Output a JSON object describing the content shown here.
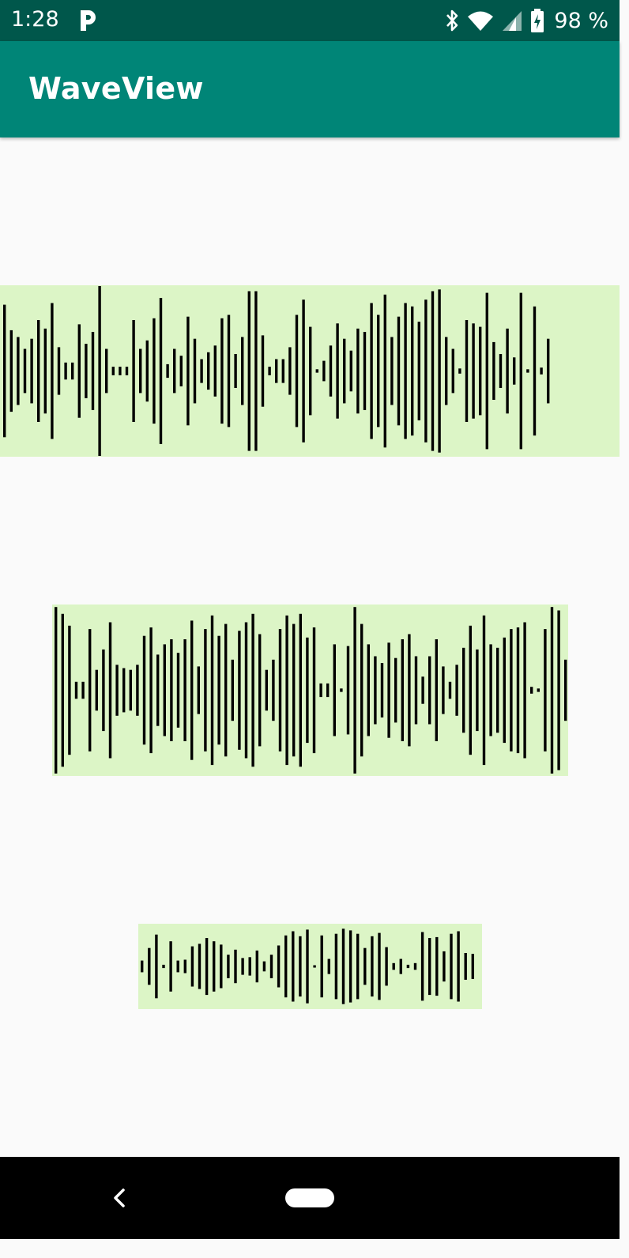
{
  "status_bar": {
    "time": "1:28",
    "notification_icon": "parking-p-icon",
    "icons": [
      "bluetooth-icon",
      "wifi-icon",
      "cell-signal-icon",
      "battery-charging-icon"
    ],
    "battery_text": "98 %",
    "background": "#00574b"
  },
  "app_bar": {
    "title": "WaveView",
    "background": "#008577"
  },
  "waves": {
    "background": "#dcf5c6",
    "bar_color": "#000000",
    "large": {
      "amplitudes": [
        0.78,
        0.48,
        0.4,
        0.26,
        0.38,
        0.6,
        0.5,
        0.8,
        0.28,
        0.1,
        0.1,
        0.55,
        0.32,
        0.46,
        1.0,
        0.26,
        0.05,
        0.05,
        0.05,
        0.6,
        0.26,
        0.36,
        0.62,
        0.86,
        0.08,
        0.26,
        0.18,
        0.64,
        0.38,
        0.14,
        0.22,
        0.3,
        0.62,
        0.66,
        0.2,
        0.4,
        0.94,
        0.94,
        0.42,
        0.05,
        0.14,
        0.14,
        0.28,
        0.66,
        0.84,
        0.52,
        0.02,
        0.12,
        0.3,
        0.56,
        0.38,
        0.24,
        0.5,
        0.46,
        0.8,
        0.66,
        0.9,
        0.4,
        0.64,
        0.8,
        0.76,
        0.58,
        0.84,
        0.94,
        0.96,
        0.4,
        0.26,
        0.03,
        0.6,
        0.56,
        0.52,
        0.92,
        0.34,
        0.2,
        0.5,
        0.16,
        0.92,
        0.02,
        0.76,
        0.04,
        0.38
      ]
    },
    "medium": {
      "amplitudes": [
        0.98,
        0.9,
        0.76,
        0.1,
        0.1,
        0.72,
        0.24,
        0.48,
        0.8,
        0.3,
        0.26,
        0.24,
        0.3,
        0.64,
        0.74,
        0.42,
        0.54,
        0.6,
        0.44,
        0.6,
        0.82,
        0.28,
        0.72,
        0.88,
        0.64,
        0.78,
        0.36,
        0.7,
        0.8,
        0.9,
        0.66,
        0.24,
        0.36,
        0.72,
        0.88,
        0.78,
        0.9,
        0.62,
        0.74,
        0.08,
        0.08,
        0.54,
        0.02,
        0.52,
        0.98,
        0.78,
        0.54,
        0.4,
        0.32,
        0.56,
        0.38,
        0.6,
        0.66,
        0.4,
        0.16,
        0.4,
        0.6,
        0.28,
        0.1,
        0.3,
        0.5,
        0.76,
        0.48,
        0.88,
        0.54,
        0.5,
        0.62,
        0.72,
        0.74,
        0.8,
        0.04,
        0.02,
        0.72,
        0.98,
        0.94,
        0.36,
        0.32
      ]
    },
    "small": {
      "amplitudes": [
        0.14,
        0.44,
        0.76,
        0.04,
        0.6,
        0.14,
        0.16,
        0.48,
        0.54,
        0.68,
        0.6,
        0.52,
        0.28,
        0.4,
        0.2,
        0.22,
        0.38,
        0.12,
        0.28,
        0.5,
        0.74,
        0.84,
        0.72,
        0.88,
        0.02,
        0.74,
        0.18,
        0.78,
        0.9,
        0.86,
        0.78,
        0.44,
        0.72,
        0.8,
        0.46,
        0.08,
        0.18,
        0.04,
        0.08,
        0.82,
        0.68,
        0.7,
        0.36,
        0.78,
        0.84,
        0.32,
        0.3
      ]
    }
  },
  "nav_bar": {
    "back_icon": "back-chevron-icon",
    "home_icon": "home-pill-icon"
  }
}
